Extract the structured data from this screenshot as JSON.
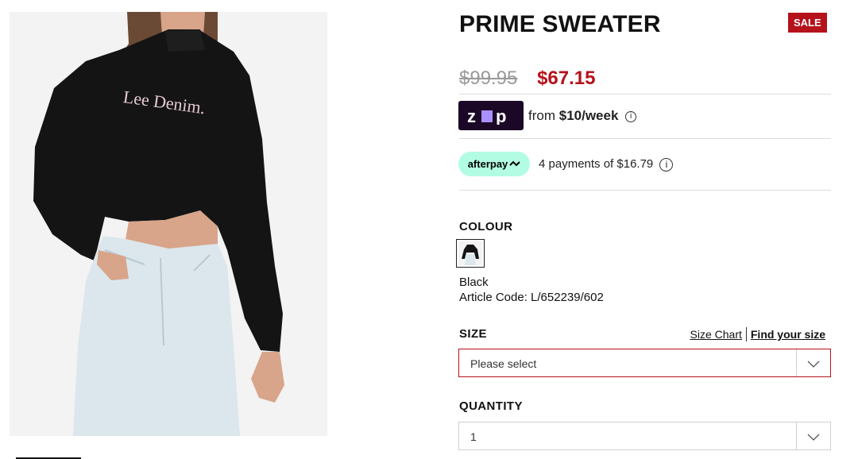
{
  "product": {
    "title": "PRIME SWEATER",
    "sale_badge": "SALE",
    "price_was": "$99.95",
    "price_now": "$67.15",
    "image_text": "Lee Denim."
  },
  "zip": {
    "logo_text": "zip",
    "text_prefix": "from ",
    "amount": "$10/week",
    "info_icon": "i"
  },
  "afterpay": {
    "logo_text": "afterpay",
    "text": "4 payments of $16.79",
    "info_icon": "i"
  },
  "colour": {
    "label": "COLOUR",
    "selected": "Black",
    "article_code": "Article Code: L/652239/602"
  },
  "size": {
    "label": "SIZE",
    "size_chart_link": "Size Chart",
    "find_size_link": "Find your size",
    "placeholder": "Please select"
  },
  "quantity": {
    "label": "QUANTITY",
    "value": "1"
  },
  "colors": {
    "sale_red": "#b5121b",
    "zip_purple": "#1a0826",
    "afterpay_mint": "#b2fce4"
  }
}
